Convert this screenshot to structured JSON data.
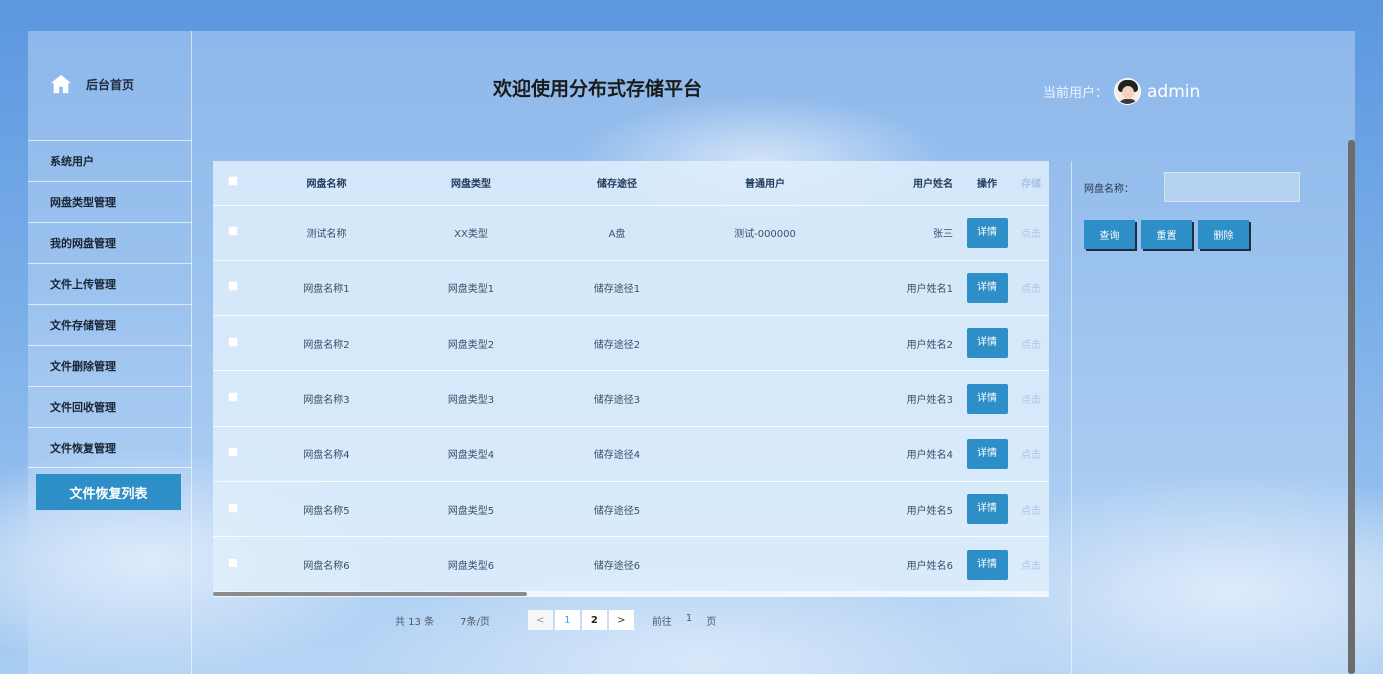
{
  "sidebar": {
    "home_label": "后台首页",
    "items": [
      {
        "label": "系统用户"
      },
      {
        "label": "网盘类型管理"
      },
      {
        "label": "我的网盘管理"
      },
      {
        "label": "文件上传管理"
      },
      {
        "label": "文件存储管理"
      },
      {
        "label": "文件删除管理"
      },
      {
        "label": "文件回收管理"
      },
      {
        "label": "文件恢复管理"
      }
    ],
    "active_label": "文件恢复列表"
  },
  "header": {
    "title": "欢迎使用分布式存储平台",
    "user_label": "当前用户：",
    "username": "admin"
  },
  "table": {
    "columns": [
      "网盘名称",
      "网盘类型",
      "储存途径",
      "普通用户",
      "用户姓名",
      "操作",
      "存储"
    ],
    "detail_label": "详情",
    "extra_label": "点击",
    "rows": [
      {
        "name": "测试名称",
        "type": "XX类型",
        "path": "A盘",
        "user": "测试-000000",
        "username": "张三"
      },
      {
        "name": "网盘名称1",
        "type": "网盘类型1",
        "path": "储存途径1",
        "user": "",
        "username": "用户姓名1"
      },
      {
        "name": "网盘名称2",
        "type": "网盘类型2",
        "path": "储存途径2",
        "user": "",
        "username": "用户姓名2"
      },
      {
        "name": "网盘名称3",
        "type": "网盘类型3",
        "path": "储存途径3",
        "user": "",
        "username": "用户姓名3"
      },
      {
        "name": "网盘名称4",
        "type": "网盘类型4",
        "path": "储存途径4",
        "user": "",
        "username": "用户姓名4"
      },
      {
        "name": "网盘名称5",
        "type": "网盘类型5",
        "path": "储存途径5",
        "user": "",
        "username": "用户姓名5"
      },
      {
        "name": "网盘名称6",
        "type": "网盘类型6",
        "path": "储存途径6",
        "user": "",
        "username": "用户姓名6"
      }
    ]
  },
  "pagination": {
    "total": "共 13 条",
    "page_size": "7条/页",
    "prev": "<",
    "pages": [
      "1",
      "2"
    ],
    "next": ">",
    "goto_label": "前往",
    "goto_value": "1",
    "page_suffix": "页"
  },
  "search": {
    "label": "网盘名称：",
    "value": "",
    "query_label": "查询",
    "reset_label": "重置",
    "delete_label": "删除"
  },
  "colors": {
    "accent": "#2e8ec7",
    "background": "#7aaee8"
  }
}
